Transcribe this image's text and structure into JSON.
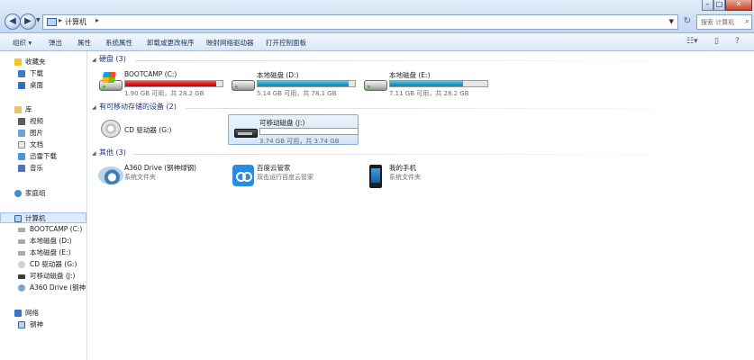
{
  "address": {
    "crumb": "计算机",
    "search_placeholder": "搜索 计算机"
  },
  "toolbar": {
    "items": [
      "组织 ▾",
      "弹出",
      "属性",
      "系统属性",
      "卸载或更改程序",
      "映射网络驱动器",
      "打开控制面板"
    ]
  },
  "nav": {
    "favorites": "收藏夹",
    "downloads": "下载",
    "desktop": "桌面",
    "libraries": "库",
    "videos": "视频",
    "pictures": "图片",
    "documents": "文档",
    "xunlei": "迅雷下载",
    "music": "音乐",
    "homegroup": "家庭组",
    "computer": "计算机",
    "bootcamp": "BOOTCAMP (C:)",
    "local_d": "本地磁盘 (D:)",
    "local_e": "本地磁盘 (E:)",
    "cd_g": "CD 驱动器 (G:)",
    "removable_j": "可移动磁盘 (J:)",
    "a360": "A360 Drive (钢神",
    "network": "网络",
    "net_pc": "钢神"
  },
  "groups": {
    "hard_disks": "硬盘 (3)",
    "removable": "有可移动存储的设备 (2)",
    "other": "其他 (3)"
  },
  "drives": [
    {
      "name": "BOOTCAMP (C:)",
      "free": "1.90 GB 可用，共 28.2 GB",
      "used_fraction": 0.93,
      "color": "#d21515"
    },
    {
      "name": "本地磁盘 (D:)",
      "free": "5.14 GB 可用，共 78.1 GB",
      "used_fraction": 0.93,
      "color": "#1b98c4"
    },
    {
      "name": "本地磁盘 (E:)",
      "free": "7.11 GB 可用，共 28.2 GB",
      "used_fraction": 0.75,
      "color": "#1b98c4"
    }
  ],
  "removable_devices": {
    "cd": "CD 驱动器 (G:)",
    "usb_name": "可移动磁盘 (J:)",
    "usb_free": "3.74 GB 可用，共 3.74 GB",
    "usb_used_fraction": 0.0
  },
  "other_items": [
    {
      "name": "A360 Drive (钢神绿钢)",
      "type": "系统文件夹"
    },
    {
      "name": "百度云管家",
      "type": "双击运行百度云管家"
    },
    {
      "name": "我的手机",
      "type": "系统文件夹"
    }
  ]
}
